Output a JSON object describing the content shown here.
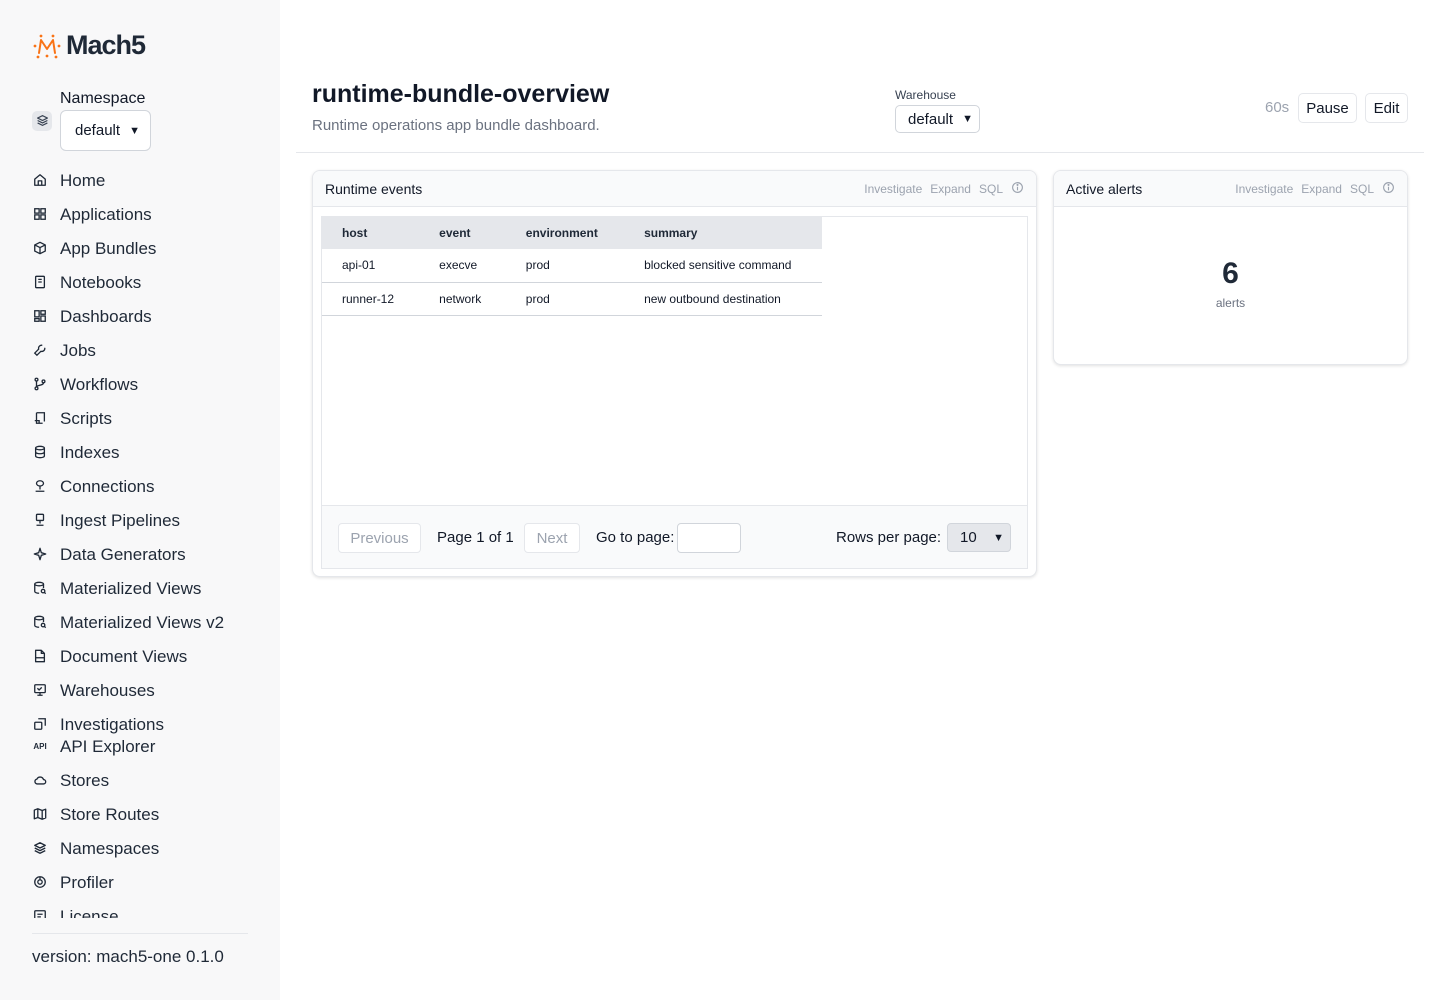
{
  "brand": {
    "name": "Mach5",
    "accent_color": "#f97316"
  },
  "sidebar": {
    "namespace_label": "Namespace",
    "namespace_value": "default",
    "items": [
      {
        "label": "Home",
        "icon": "home-icon"
      },
      {
        "label": "Applications",
        "icon": "applications-icon"
      },
      {
        "label": "App Bundles",
        "icon": "package-icon"
      },
      {
        "label": "Notebooks",
        "icon": "notebook-icon"
      },
      {
        "label": "Dashboards",
        "icon": "dashboard-icon"
      },
      {
        "label": "Jobs",
        "icon": "wrench-icon"
      },
      {
        "label": "Workflows",
        "icon": "git-branch-icon"
      },
      {
        "label": "Scripts",
        "icon": "scroll-icon"
      },
      {
        "label": "Indexes",
        "icon": "database-icon"
      },
      {
        "label": "Connections",
        "icon": "connection-icon"
      },
      {
        "label": "Ingest Pipelines",
        "icon": "pipeline-icon"
      },
      {
        "label": "Data Generators",
        "icon": "sparkle-icon"
      },
      {
        "label": "Materialized Views",
        "icon": "database-search-icon"
      },
      {
        "label": "Materialized Views v2",
        "icon": "database-search-icon"
      },
      {
        "label": "Document Views",
        "icon": "file-icon"
      },
      {
        "label": "Warehouses",
        "icon": "monitor-icon"
      },
      {
        "label": "Investigations",
        "icon": "investigation-icon"
      },
      {
        "label": "API Explorer",
        "icon": "api-icon"
      },
      {
        "label": "Stores",
        "icon": "cloud-icon"
      },
      {
        "label": "Store Routes",
        "icon": "map-icon"
      },
      {
        "label": "Namespaces",
        "icon": "layers-icon"
      },
      {
        "label": "Profiler",
        "icon": "profiler-icon"
      },
      {
        "label": "License",
        "icon": "license-icon"
      }
    ],
    "version": "version: mach5-one 0.1.0"
  },
  "header": {
    "title": "runtime-bundle-overview",
    "subtitle": "Runtime operations app bundle dashboard.",
    "warehouse_label": "Warehouse",
    "warehouse_value": "default",
    "refresh_interval": "60s",
    "pause_label": "Pause",
    "edit_label": "Edit"
  },
  "panels": {
    "events": {
      "title": "Runtime events",
      "actions": {
        "investigate": "Investigate",
        "expand": "Expand",
        "sql": "SQL"
      },
      "columns": [
        "host",
        "event",
        "environment",
        "summary"
      ],
      "rows": [
        [
          "api-01",
          "execve",
          "prod",
          "blocked sensitive command"
        ],
        [
          "runner-12",
          "network",
          "prod",
          "new outbound destination"
        ]
      ],
      "pager": {
        "previous": "Previous",
        "page_info": "Page 1 of 1",
        "next": "Next",
        "goto_label": "Go to page:",
        "rows_label": "Rows per page:",
        "rows_value": "10"
      }
    },
    "alerts": {
      "title": "Active alerts",
      "actions": {
        "investigate": "Investigate",
        "expand": "Expand",
        "sql": "SQL"
      },
      "value": "6",
      "unit": "alerts"
    }
  }
}
